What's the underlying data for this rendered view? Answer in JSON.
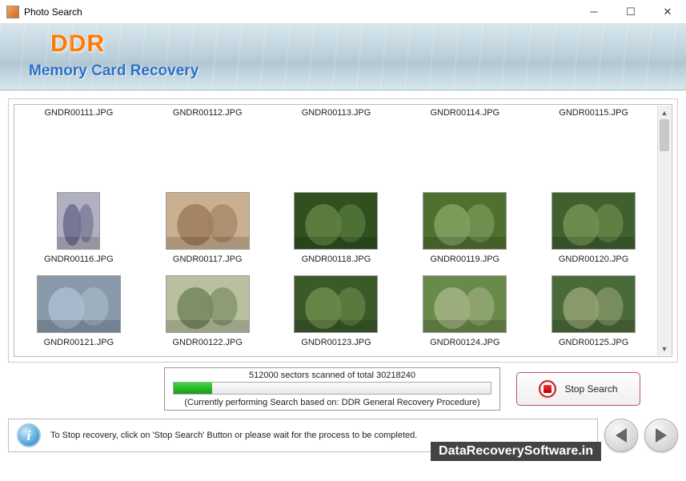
{
  "window": {
    "title": "Photo Search"
  },
  "banner": {
    "logo": "DDR",
    "subtitle": "Memory Card Recovery"
  },
  "thumbnails": [
    {
      "file": "GNDR00111.JPG",
      "row": 1
    },
    {
      "file": "GNDR00112.JPG",
      "row": 1
    },
    {
      "file": "GNDR00113.JPG",
      "row": 1
    },
    {
      "file": "GNDR00114.JPG",
      "row": 1
    },
    {
      "file": "GNDR00115.JPG",
      "row": 1
    },
    {
      "file": "GNDR00116.JPG",
      "row": 2
    },
    {
      "file": "GNDR00117.JPG",
      "row": 2
    },
    {
      "file": "GNDR00118.JPG",
      "row": 2
    },
    {
      "file": "GNDR00119.JPG",
      "row": 2
    },
    {
      "file": "GNDR00120.JPG",
      "row": 2
    },
    {
      "file": "GNDR00121.JPG",
      "row": 3
    },
    {
      "file": "GNDR00122.JPG",
      "row": 3
    },
    {
      "file": "GNDR00123.JPG",
      "row": 3
    },
    {
      "file": "GNDR00124.JPG",
      "row": 3
    },
    {
      "file": "GNDR00125.JPG",
      "row": 3
    }
  ],
  "progress": {
    "text": "512000 sectors scanned of total 30218240",
    "note": "(Currently performing Search based on:  DDR General Recovery Procedure)",
    "percent": 12
  },
  "buttons": {
    "stop": "Stop Search"
  },
  "info": {
    "text": "To Stop recovery, click on 'Stop Search' Button or please wait for the process to be completed."
  },
  "watermark": "DataRecoverySoftware.in"
}
